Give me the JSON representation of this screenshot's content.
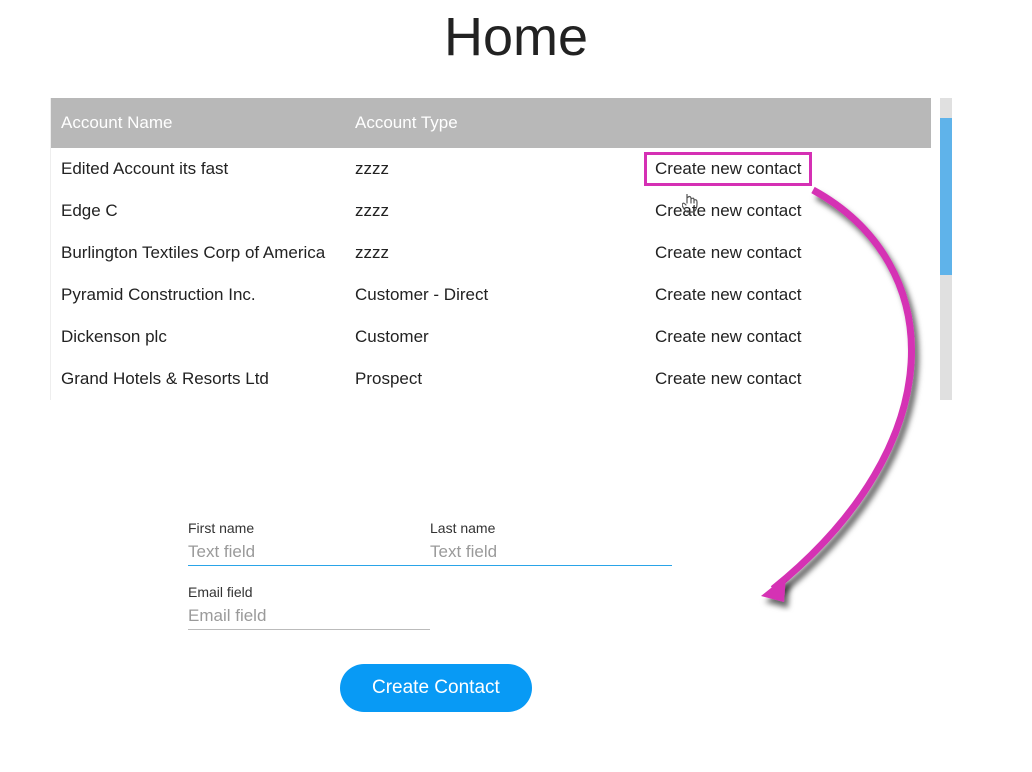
{
  "page_title": "Home",
  "table": {
    "headers": {
      "name": "Account Name",
      "type": "Account Type",
      "action": ""
    },
    "action_label": "Create new contact",
    "rows": [
      {
        "name": "Edited Account its fast",
        "type": "zzzz",
        "highlighted": true
      },
      {
        "name": "Edge C",
        "type": "zzzz",
        "highlighted": false
      },
      {
        "name": "Burlington Textiles Corp of America",
        "type": "zzzz",
        "highlighted": false
      },
      {
        "name": "Pyramid Construction Inc.",
        "type": "Customer - Direct",
        "highlighted": false
      },
      {
        "name": "Dickenson plc",
        "type": "Customer",
        "highlighted": false
      },
      {
        "name": "Grand Hotels & Resorts Ltd",
        "type": "Prospect",
        "highlighted": false
      }
    ]
  },
  "form": {
    "first_name": {
      "label": "First name",
      "placeholder": "Text field",
      "value": ""
    },
    "last_name": {
      "label": "Last name",
      "placeholder": "Text field",
      "value": ""
    },
    "email": {
      "label": "Email field",
      "placeholder": "Email field",
      "value": ""
    },
    "submit_label": "Create Contact"
  }
}
